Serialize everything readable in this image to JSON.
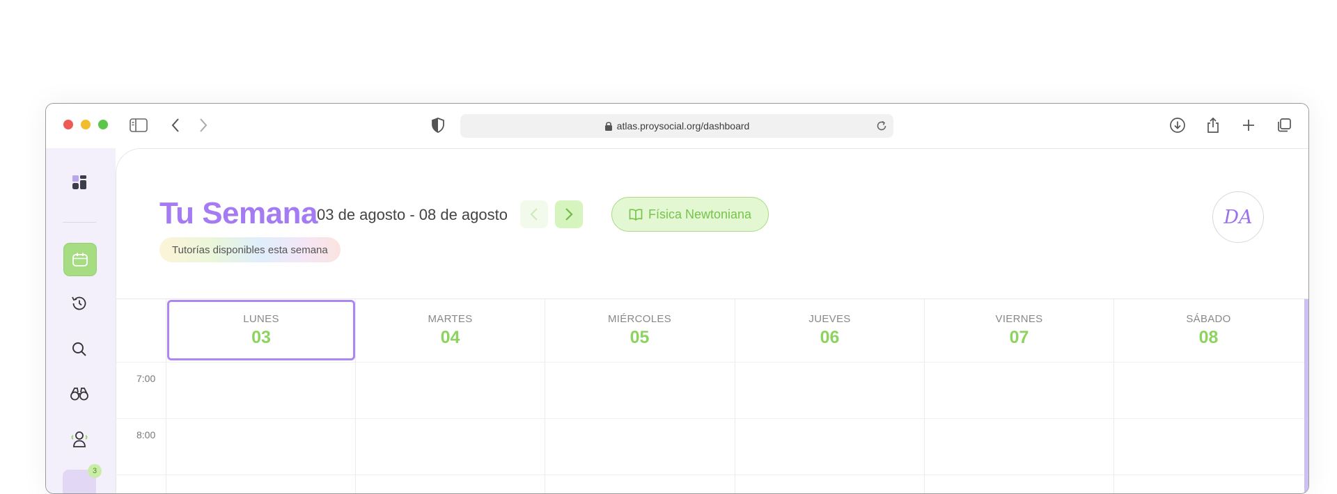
{
  "browser": {
    "url": "atlas.proysocial.org/dashboard"
  },
  "sidebar": {
    "badge_count": "3"
  },
  "header": {
    "title": "Tu Semana",
    "date_range": "03 de agosto - 08 de agosto",
    "subject": "Física Newtoniana",
    "availability": "Tutorías disponibles esta semana",
    "avatar_initials": "DA"
  },
  "calendar": {
    "days": [
      {
        "name": "LUNES",
        "number": "03"
      },
      {
        "name": "MARTES",
        "number": "04"
      },
      {
        "name": "MIÉRCOLES",
        "number": "05"
      },
      {
        "name": "JUEVES",
        "number": "06"
      },
      {
        "name": "VIERNES",
        "number": "07"
      },
      {
        "name": "SÁBADO",
        "number": "08"
      }
    ],
    "times": [
      "7:00",
      "8:00"
    ]
  },
  "colors": {
    "accent_purple": "#a57bf4",
    "accent_green": "#8dd35f"
  }
}
